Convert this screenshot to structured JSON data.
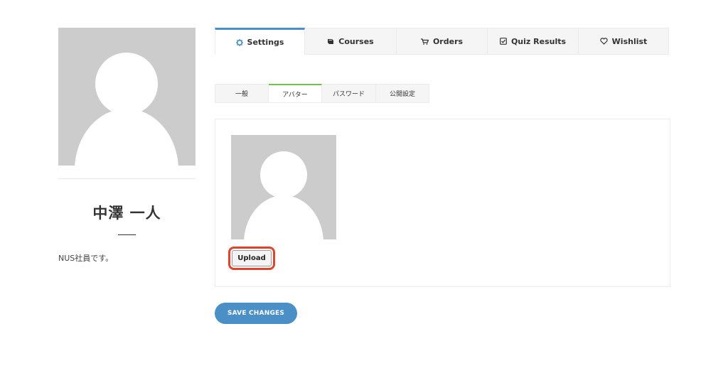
{
  "profile": {
    "name": "中澤 一人",
    "bio": "NUS社員です。"
  },
  "main_tabs": [
    {
      "label": "Settings",
      "icon": "gear-icon",
      "active": true
    },
    {
      "label": "Courses",
      "icon": "book-icon",
      "active": false
    },
    {
      "label": "Orders",
      "icon": "cart-icon",
      "active": false
    },
    {
      "label": "Quiz Results",
      "icon": "check-square-icon",
      "active": false
    },
    {
      "label": "Wishlist",
      "icon": "heart-icon",
      "active": false
    }
  ],
  "sub_tabs": [
    {
      "label": "一般",
      "active": false
    },
    {
      "label": "アバター",
      "active": true
    },
    {
      "label": "パスワード",
      "active": false
    },
    {
      "label": "公開設定",
      "active": false
    }
  ],
  "avatar_panel": {
    "upload_label": "Upload"
  },
  "actions": {
    "save_label": "SAVE CHANGES"
  },
  "colors": {
    "accent_blue": "#4a8fc5",
    "tab_active_green": "#6cc24a",
    "highlight_red": "#e0452c",
    "placeholder_gray": "#cccccc"
  }
}
